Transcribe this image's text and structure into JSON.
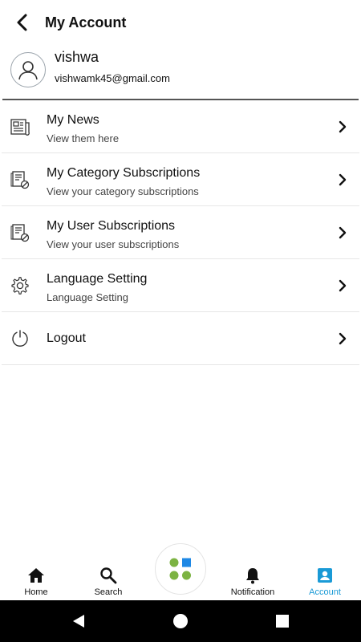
{
  "header": {
    "title": "My Account"
  },
  "profile": {
    "name": "vishwa",
    "email": "vishwamk45@gmail.com"
  },
  "menu": [
    {
      "title": "My News",
      "subtitle": "View them here",
      "icon": "newspaper-icon"
    },
    {
      "title": "My Category Subscriptions",
      "subtitle": "View your category subscriptions",
      "icon": "subscription-list-icon"
    },
    {
      "title": "My User Subscriptions",
      "subtitle": "View your user subscriptions",
      "icon": "subscription-list-icon"
    },
    {
      "title": "Language Setting",
      "subtitle": "Language Setting",
      "icon": "gear-icon"
    },
    {
      "title": "Logout",
      "icon": "power-icon"
    }
  ],
  "bottom_nav": {
    "home": "Home",
    "search": "Search",
    "notification": "Notification",
    "account": "Account",
    "active": "Account"
  },
  "colors": {
    "accent": "#1a9ad6",
    "fab_green": "#7cb342",
    "fab_blue": "#1e88e5"
  }
}
